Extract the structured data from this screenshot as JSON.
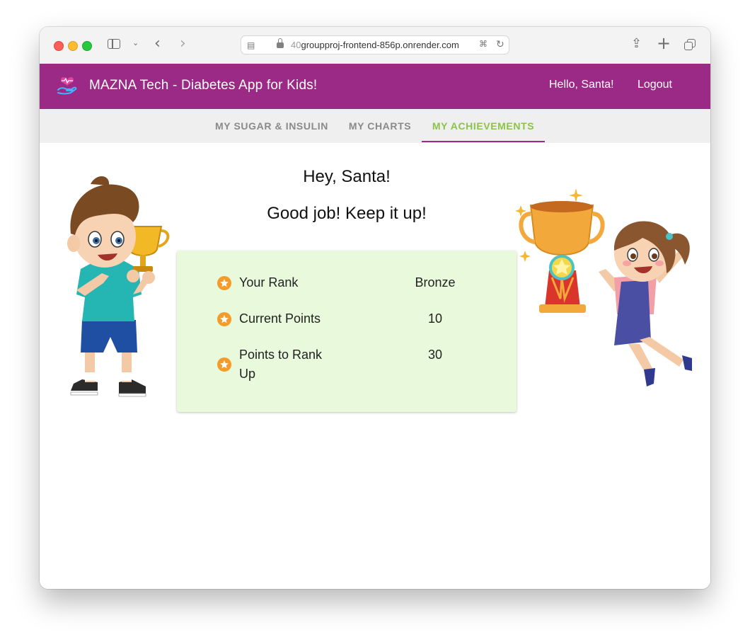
{
  "browser": {
    "url_prefix": "40",
    "url_main": "groupproj-frontend-856p.onrender.com"
  },
  "header": {
    "title": "MAZNA Tech - Diabetes App for Kids!",
    "greeting": "Hello, Santa!",
    "logout_label": "Logout",
    "color": "#9b2a87"
  },
  "tabs": [
    {
      "label": "MY SUGAR & INSULIN",
      "active": false
    },
    {
      "label": "MY CHARTS",
      "active": false
    },
    {
      "label": "MY ACHIEVEMENTS",
      "active": true
    }
  ],
  "main": {
    "heading": "Hey, Santa!",
    "subheading": "Good job! Keep it up!",
    "stats": [
      {
        "label": "Your Rank",
        "value": "Bronze"
      },
      {
        "label": "Current Points",
        "value": "10"
      },
      {
        "label": "Points to Rank Up",
        "value": "30"
      }
    ]
  },
  "icons": {
    "logo": "heart-hand-icon",
    "stat_icon": "star-icon",
    "illustrations": [
      "boy-with-trophy",
      "girl-with-trophy"
    ]
  },
  "colors": {
    "active_tab": "#8bc34a",
    "card_bg": "#e9fadc",
    "star_badge": "#f39c2a"
  }
}
